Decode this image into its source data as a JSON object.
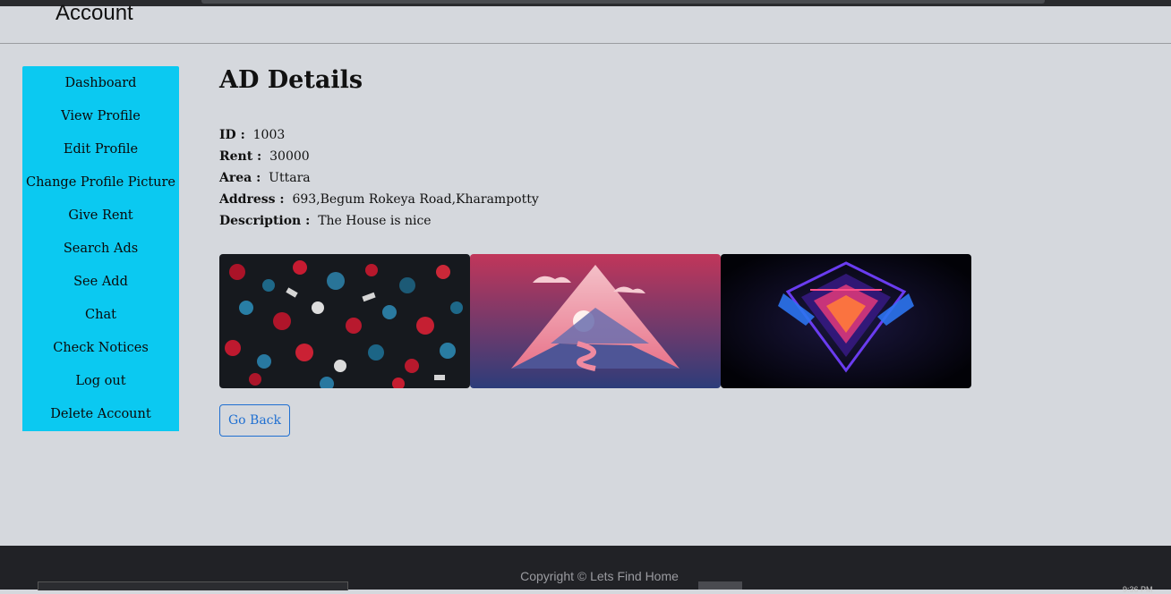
{
  "header": {
    "title": "Account"
  },
  "sidebar": {
    "items": [
      {
        "label": "Dashboard"
      },
      {
        "label": "View Profile"
      },
      {
        "label": "Edit Profile"
      },
      {
        "label": "Change Profile Picture"
      },
      {
        "label": "Give Rent"
      },
      {
        "label": "Search Ads"
      },
      {
        "label": "See Add"
      },
      {
        "label": "Chat"
      },
      {
        "label": "Check Notices"
      },
      {
        "label": "Log out"
      },
      {
        "label": "Delete Account"
      }
    ]
  },
  "main": {
    "title": "AD Details",
    "details": [
      {
        "label": "ID :",
        "value": "1003"
      },
      {
        "label": "Rent :",
        "value": "30000"
      },
      {
        "label": "Area :",
        "value": "Uttara"
      },
      {
        "label": "Address :",
        "value": "693,Begum Rokeya Road,Kharampotty"
      },
      {
        "label": "Description :",
        "value": "The House is nice"
      }
    ],
    "go_back_label": "Go Back"
  },
  "footer": {
    "copyright": "Copyright © Lets Find Home",
    "clock": "9:36 PM"
  },
  "colors": {
    "sidebar": "#0bc9f1",
    "background": "#d5d8dd",
    "button": "#1f6fd1",
    "footer": "#212226"
  }
}
